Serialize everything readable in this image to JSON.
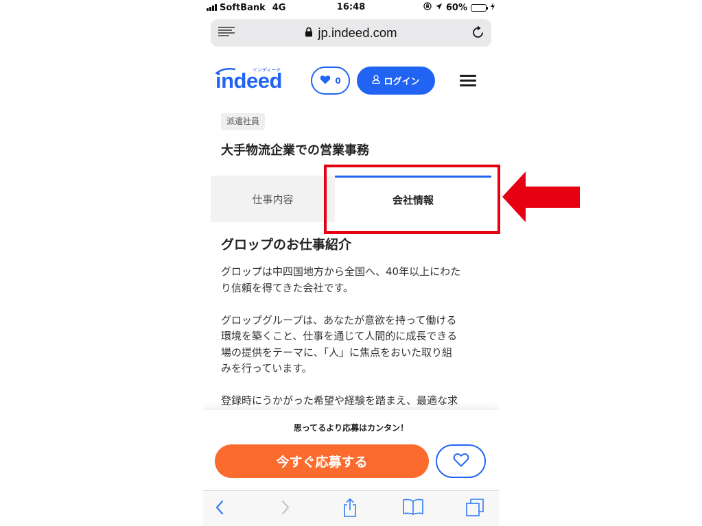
{
  "status_bar": {
    "carrier": "SoftBank",
    "network": "4G",
    "time": "16:48",
    "battery": "60%"
  },
  "address_bar": {
    "url": "jp.indeed.com"
  },
  "header": {
    "logo_text": "indeed",
    "logo_kana": "インディード",
    "favorites_count": "0",
    "login_label": "ログイン"
  },
  "job": {
    "employment_type": "派遣社員",
    "title": "大手物流企業での営業事務"
  },
  "tabs": [
    {
      "label": "仕事内容",
      "active": false
    },
    {
      "label": "会社情報",
      "active": true
    }
  ],
  "company_section": {
    "heading": "グロップのお仕事紹介",
    "paragraphs": [
      [
        "グロップは中四国地方から全国へ、40年以上にわた",
        "り信頼を得てきた会社です。"
      ],
      [
        "グロップグループは、あなたが意欲を持って働ける",
        "環境を築くこと、仕事を通じて人間的に成長できる",
        "場の提供をテーマに、「人」に焦点をおいた取り組",
        "みを行っています。"
      ],
      [
        "登録時にうかがった希望や経験を踏まえ、最適な求"
      ]
    ]
  },
  "apply_bar": {
    "prompt": "思ってるより応募はカンタン！",
    "apply_label": "今すぐ応募する"
  },
  "navigation": {
    "back_enabled": true,
    "forward_enabled": false
  },
  "icons": {
    "status": [
      "signal-strength-icon",
      "orientation-lock-icon",
      "location-icon",
      "battery-icon",
      "charging-icon"
    ],
    "address_bar": [
      "reader-icon",
      "lock-icon",
      "reload-icon"
    ],
    "header": [
      "heart-icon",
      "person-icon",
      "hamburger-menu-icon"
    ],
    "apply_bar": [
      "heart-outline-icon"
    ],
    "toolbar": [
      "back-icon",
      "forward-icon",
      "share-icon",
      "bookmarks-icon",
      "tabs-icon"
    ]
  },
  "colors": {
    "brand_blue": "#2164f3",
    "apply_orange": "#fa6b2d",
    "annotation_red": "#e60012",
    "safari_blue": "#2f7cf6",
    "text_dark": "#2d2d2d"
  }
}
